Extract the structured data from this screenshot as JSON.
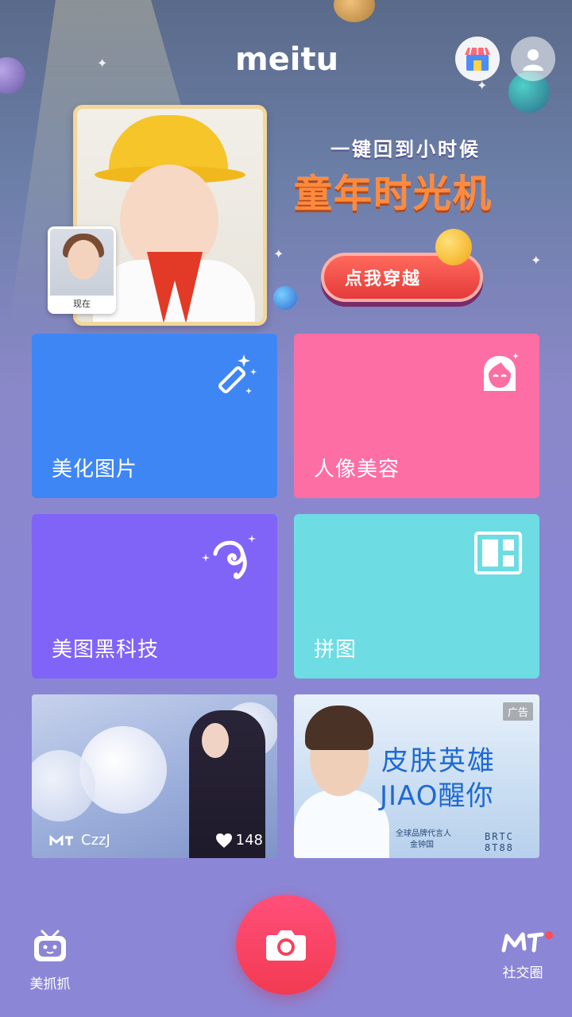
{
  "header": {
    "logo": "meitu",
    "store_icon": "store-icon",
    "profile_icon": "user-icon"
  },
  "banner": {
    "subtitle": "一键回到小时候",
    "title": "童年时光机",
    "button_label": "点我穿越",
    "thumb_label": "现在"
  },
  "tiles": [
    {
      "label": "美化图片",
      "icon": "magic-wand-icon",
      "color": "#3f86f5"
    },
    {
      "label": "人像美容",
      "icon": "face-icon",
      "color": "#fd6ea4"
    },
    {
      "label": "美图黑科技",
      "icon": "tech-sparkle-icon",
      "color": "#8064f8"
    },
    {
      "label": "拼图",
      "icon": "collage-icon",
      "color": "#6ddce3"
    }
  ],
  "feed": {
    "user_card": {
      "username": "CzzJ",
      "likes": "148"
    },
    "ad_card": {
      "tag": "广告",
      "headline1": "皮肤英雄",
      "headline2": "JIAO醒你",
      "small1": "全球品牌代言人",
      "small2": "金钟国",
      "brand": "BRTC 8T88"
    }
  },
  "bottom_nav": {
    "left_label": "美抓抓",
    "right_label": "社交圈",
    "camera_icon": "camera-icon"
  }
}
